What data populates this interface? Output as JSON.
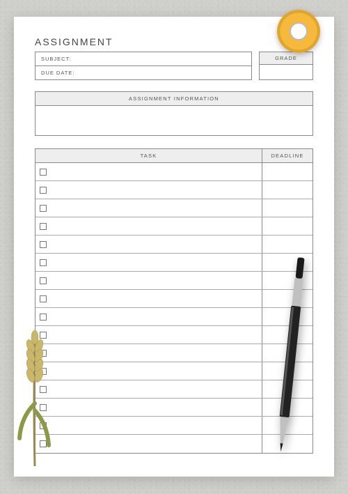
{
  "title": "ASSIGNMENT",
  "fields": {
    "subject_label": "SUBJECT:",
    "duedate_label": "DUE DATE:",
    "grade_label": "GRADE"
  },
  "info": {
    "header": "ASSIGNMENT INFORMATION"
  },
  "table": {
    "task_header": "TASK",
    "deadline_header": "DEADLINE",
    "rows": [
      {
        "checked": false,
        "task": "",
        "deadline": ""
      },
      {
        "checked": false,
        "task": "",
        "deadline": ""
      },
      {
        "checked": false,
        "task": "",
        "deadline": ""
      },
      {
        "checked": false,
        "task": "",
        "deadline": ""
      },
      {
        "checked": false,
        "task": "",
        "deadline": ""
      },
      {
        "checked": false,
        "task": "",
        "deadline": ""
      },
      {
        "checked": false,
        "task": "",
        "deadline": ""
      },
      {
        "checked": false,
        "task": "",
        "deadline": ""
      },
      {
        "checked": false,
        "task": "",
        "deadline": ""
      },
      {
        "checked": false,
        "task": "",
        "deadline": ""
      },
      {
        "checked": false,
        "task": "",
        "deadline": ""
      },
      {
        "checked": false,
        "task": "",
        "deadline": ""
      },
      {
        "checked": false,
        "task": "",
        "deadline": ""
      },
      {
        "checked": false,
        "task": "",
        "deadline": ""
      },
      {
        "checked": false,
        "task": "",
        "deadline": ""
      },
      {
        "checked": false,
        "task": "",
        "deadline": ""
      }
    ]
  }
}
